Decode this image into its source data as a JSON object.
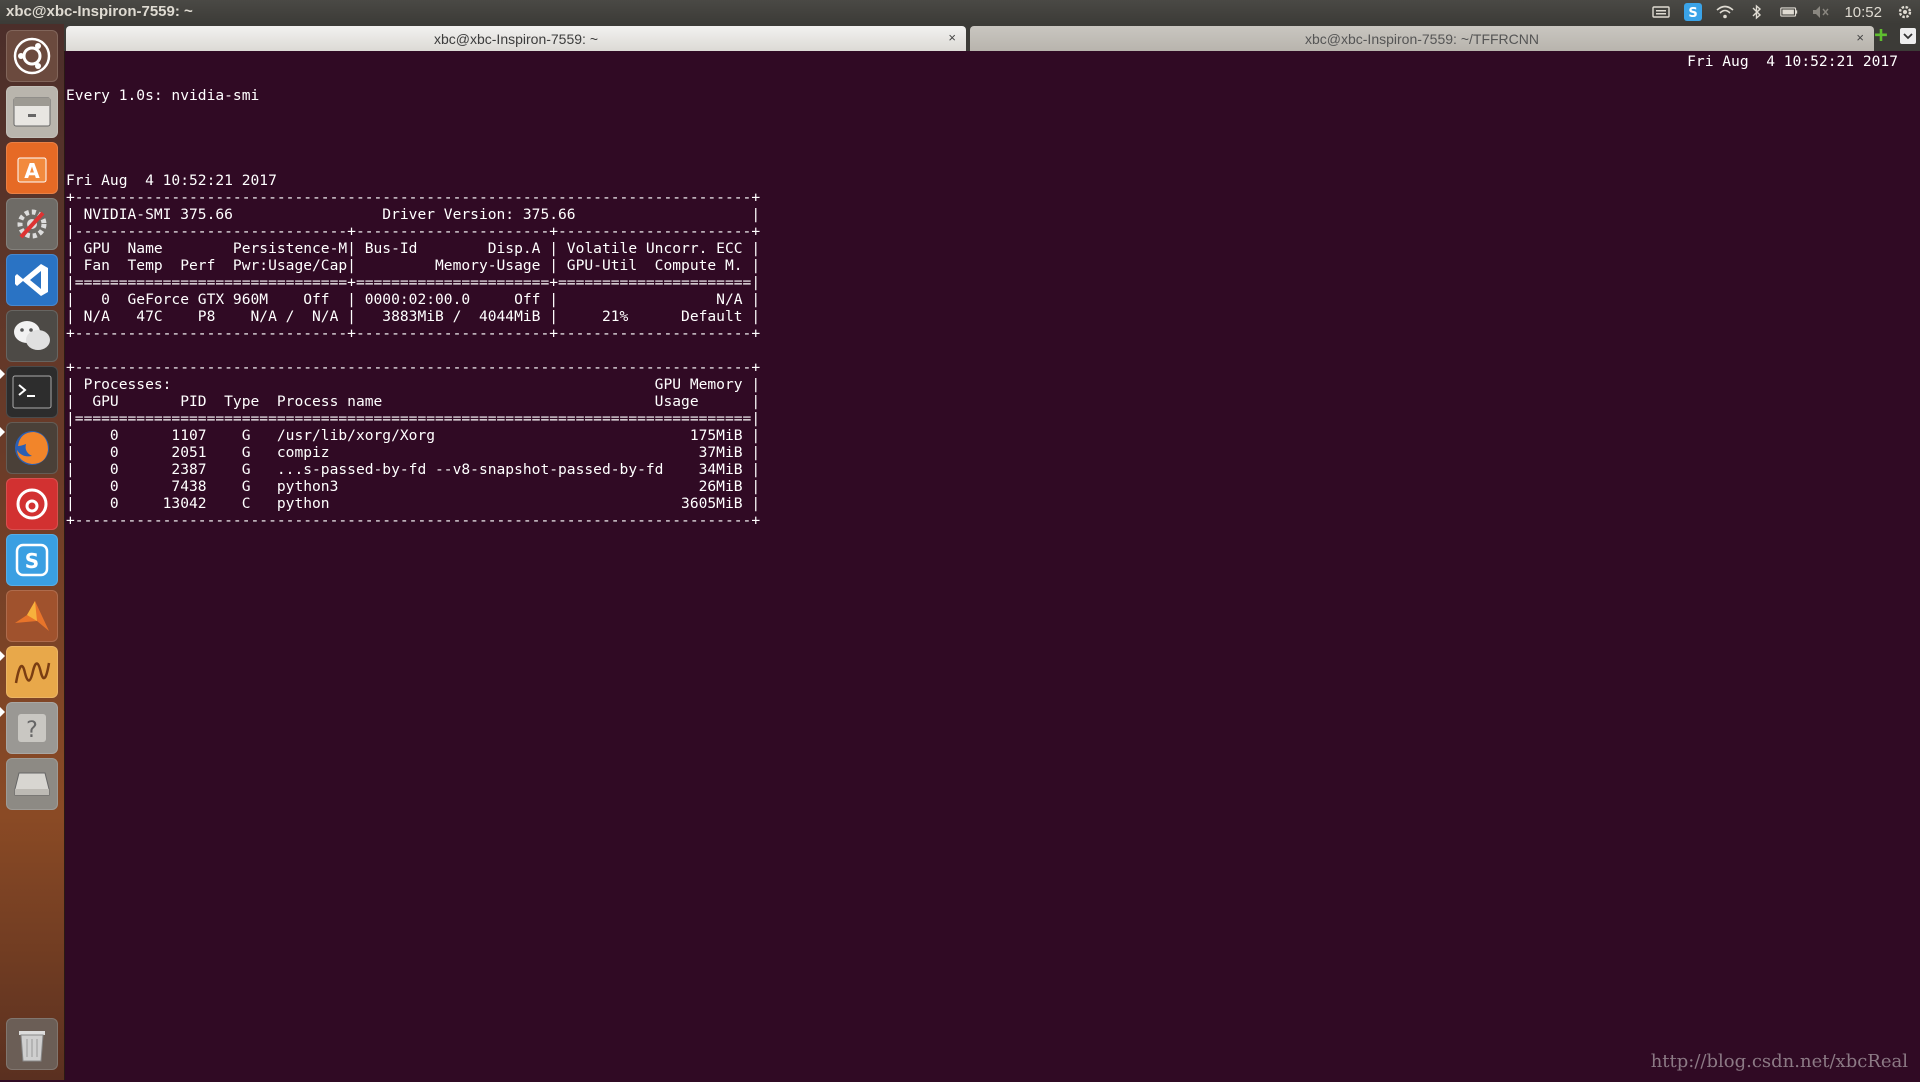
{
  "top_panel": {
    "title": "xbc@xbc-Inspiron-7559: ~",
    "clock": "10:52"
  },
  "tabs": [
    {
      "label": "xbc@xbc-Inspiron-7559: ~",
      "close": "×"
    },
    {
      "label": "xbc@xbc-Inspiron-7559: ~/TFFRCNN",
      "close": "×"
    }
  ],
  "terminal": {
    "header_left": "Every 1.0s: nvidia-smi",
    "header_right": "Fri Aug  4 10:52:21 2017",
    "lines": [
      "",
      "Fri Aug  4 10:52:21 2017",
      "+-----------------------------------------------------------------------------+",
      "| NVIDIA-SMI 375.66                 Driver Version: 375.66                    |",
      "|-------------------------------+----------------------+----------------------+",
      "| GPU  Name        Persistence-M| Bus-Id        Disp.A | Volatile Uncorr. ECC |",
      "| Fan  Temp  Perf  Pwr:Usage/Cap|         Memory-Usage | GPU-Util  Compute M. |",
      "|===============================+======================+======================|",
      "|   0  GeForce GTX 960M    Off  | 0000:02:00.0     Off |                  N/A |",
      "| N/A   47C    P8    N/A /  N/A |   3883MiB /  4044MiB |     21%      Default |",
      "+-------------------------------+----------------------+----------------------+",
      "",
      "+-----------------------------------------------------------------------------+",
      "| Processes:                                                       GPU Memory |",
      "|  GPU       PID  Type  Process name                               Usage      |",
      "|=============================================================================|",
      "|    0      1107    G   /usr/lib/xorg/Xorg                             175MiB |",
      "|    0      2051    G   compiz                                          37MiB |",
      "|    0      2387    G   ...s-passed-by-fd --v8-snapshot-passed-by-fd    34MiB |",
      "|    0      7438    G   python3                                         26MiB |",
      "|    0     13042    C   python                                        3605MiB |",
      "+-----------------------------------------------------------------------------+"
    ]
  },
  "launcher": {
    "icons": [
      "ubuntu-dash-icon",
      "files-icon",
      "software-center-icon",
      "system-settings-icon",
      "vscode-icon",
      "wechat-icon",
      "terminal-icon",
      "firefox-icon",
      "netease-music-icon",
      "sogou-icon",
      "matlab-icon",
      "waveform-app-icon",
      "help-icon",
      "drive-icon",
      "trash-icon"
    ]
  },
  "watermark": "http://blog.csdn.net/xbcReal",
  "colors": {
    "terminal_bg": "#300a24",
    "terminal_fg": "#ffffff",
    "panel_bg": "#3c3b37"
  }
}
